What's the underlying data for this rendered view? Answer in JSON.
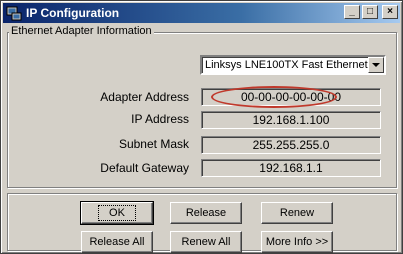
{
  "window": {
    "title": "IP Configuration",
    "controls": {
      "minimize": "_",
      "maximize": "□",
      "close": "×"
    },
    "title_gradient": [
      "#0a246a",
      "#a6caf0"
    ]
  },
  "group": {
    "legend": "Ethernet  Adapter Information",
    "adapter_selected": "Linksys LNE100TX Fast Ethernet"
  },
  "fields": [
    {
      "label": "Adapter Address",
      "value": "00-00-00-00-00-00"
    },
    {
      "label": "IP Address",
      "value": "192.168.1.100"
    },
    {
      "label": "Subnet Mask",
      "value": "255.255.255.0"
    },
    {
      "label": "Default Gateway",
      "value": "192.168.1.1"
    }
  ],
  "buttons": {
    "ok": "OK",
    "release": "Release",
    "renew": "Renew",
    "release_all": "Release All",
    "renew_all": "Renew All",
    "more_info": "More Info >>"
  },
  "colors": {
    "face": "#d4d0c8",
    "highlight_ellipse": "#c0392b"
  }
}
